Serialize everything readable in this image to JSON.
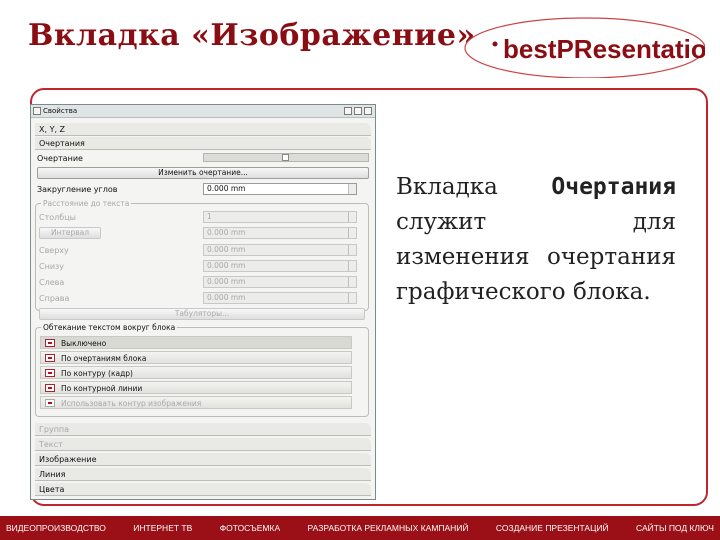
{
  "slide": {
    "title": "Вкладка «Изображение»",
    "logo_text": "bestPResentation",
    "description_prefix": "Вкладка ",
    "description_bold": "Очертания",
    "description_suffix": " служит для изменения очертания графического блока."
  },
  "footer": {
    "items": [
      "ВИДЕОПРОИЗВОДСТВО",
      "ИНТЕРНЕТ ТВ",
      "ФОТОСЪЕМКА",
      "РАЗРАБОТКА РЕКЛАМНЫХ КАМПАНИЙ",
      "СОЗДАНИЕ ПРЕЗЕНТАЦИЙ",
      "САЙТЫ ПОД КЛЮЧ"
    ]
  },
  "dialog": {
    "title": "Свойства",
    "sec_xyz": "X, Y, Z",
    "sec_outline": "Очертания",
    "outline_label": "Очертание",
    "edit_outline_btn": "Изменить очертание...",
    "corner_radius_label": "Закругление углов",
    "corner_radius_value": "0.000 mm",
    "distance_group": "Расстояние до текста",
    "columns_label": "Столбцы",
    "columns_value": "1",
    "gap_label": "Интервал",
    "gap_value": "0.000 mm",
    "top_label": "Сверху",
    "top_value": "0.000 mm",
    "bottom_label": "Снизу",
    "bottom_value": "0.000 mm",
    "left_label": "Слева",
    "left_value": "0.000 mm",
    "right_label": "Справа",
    "right_value": "0.000 mm",
    "tabulators_btn": "Табуляторы...",
    "wrap_group": "Обтекание текстом вокруг блока",
    "wrap_options": [
      "Выключено",
      "По очертаниям блока",
      "По контуру (кадр)",
      "По контурной линии",
      "Использовать контур изображения"
    ],
    "wrap_selected": 0,
    "tabs": [
      "Группа",
      "Текст",
      "Изображение",
      "Линия",
      "Цвета"
    ]
  }
}
